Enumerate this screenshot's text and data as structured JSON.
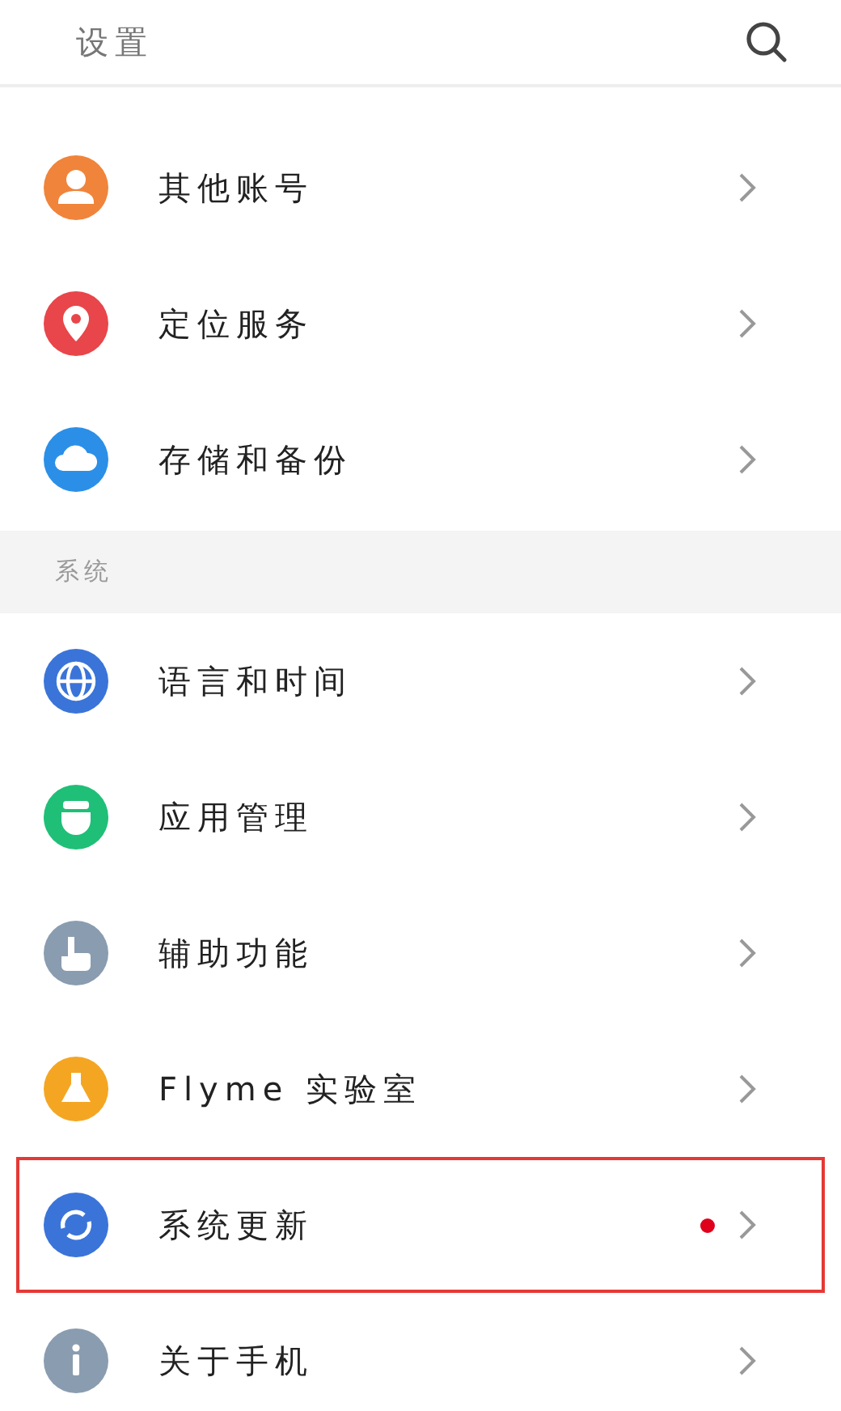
{
  "header": {
    "title": "设置"
  },
  "groups": [
    {
      "items": [
        {
          "label": "其他账号",
          "kind": "person",
          "color": "#f0843a",
          "badge": false,
          "highlighted": false
        },
        {
          "label": "定位服务",
          "kind": "pin",
          "color": "#e8464a",
          "badge": false,
          "highlighted": false
        },
        {
          "label": "存储和备份",
          "kind": "cloud",
          "color": "#2b8fe8",
          "badge": false,
          "highlighted": false
        }
      ]
    },
    {
      "title": "系统",
      "items": [
        {
          "label": "语言和时间",
          "kind": "globe",
          "color": "#3b74d9",
          "badge": false,
          "highlighted": false
        },
        {
          "label": "应用管理",
          "kind": "robot",
          "color": "#1fbf77",
          "badge": false,
          "highlighted": false
        },
        {
          "label": "辅助功能",
          "kind": "hand",
          "color": "#8a9cb0",
          "badge": false,
          "highlighted": false
        },
        {
          "label": "Flyme 实验室",
          "kind": "flask",
          "color": "#f4a623",
          "badge": false,
          "highlighted": false
        },
        {
          "label": "系统更新",
          "kind": "refresh",
          "color": "#3b74d9",
          "badge": true,
          "highlighted": true
        },
        {
          "label": "关于手机",
          "kind": "info",
          "color": "#8a9cb0",
          "badge": false,
          "highlighted": false
        }
      ]
    }
  ]
}
